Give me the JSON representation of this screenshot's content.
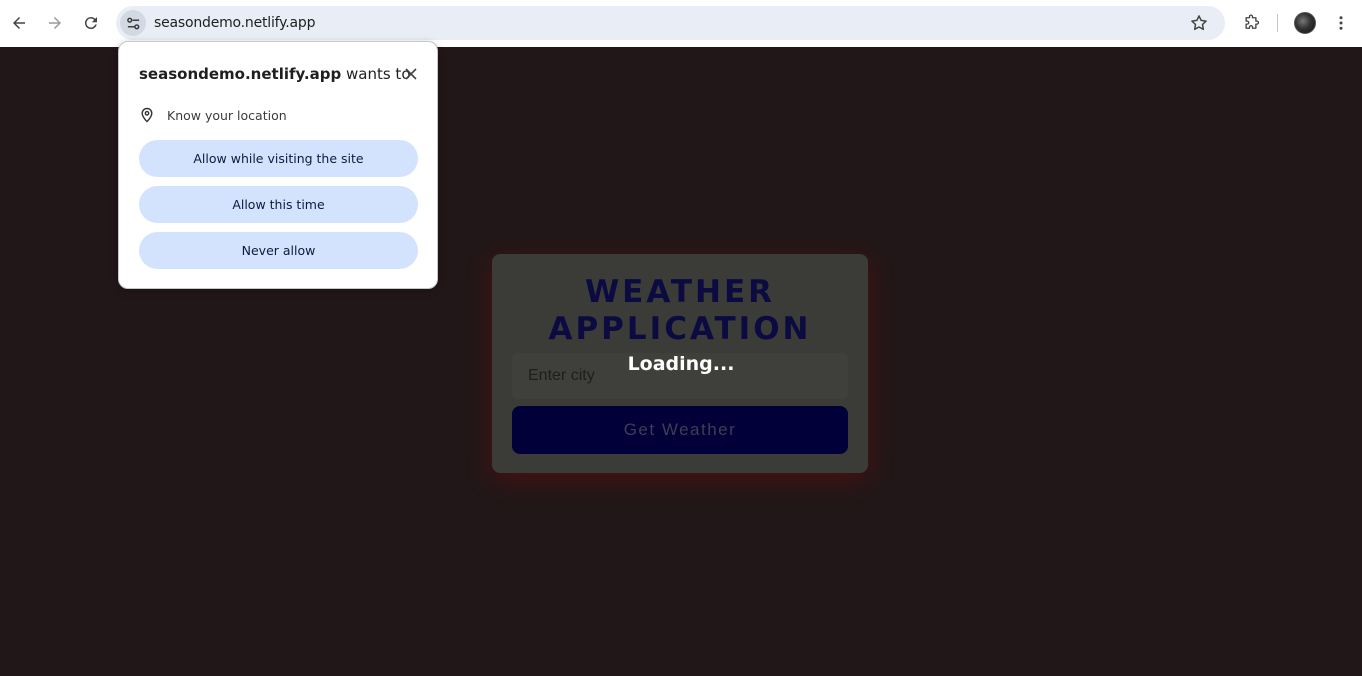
{
  "browser": {
    "url": "seasondemo.netlify.app",
    "icons": {
      "back": "arrow-left-icon",
      "forward": "arrow-right-icon",
      "reload": "reload-icon",
      "site_info": "tune-icon",
      "bookmark": "star-icon",
      "extensions": "puzzle-icon",
      "profile": "avatar",
      "menu": "kebab-menu-icon"
    }
  },
  "permission_popup": {
    "site": "seasondemo.netlify.app",
    "title_suffix": "wants to",
    "permission_label": "Know your location",
    "buttons": {
      "allow_visiting": "Allow while visiting the site",
      "allow_once": "Allow this time",
      "never": "Never allow"
    },
    "button_color": "#d3e3fd"
  },
  "app": {
    "title": "WEATHER APPLICATION",
    "city_placeholder": "Enter city",
    "city_value": "",
    "get_weather_label": "Get Weather",
    "loading_text": "Loading..."
  },
  "colors": {
    "page_background": "#221718",
    "card_background": "#3b3b37",
    "title_color": "#0b0b42",
    "button_background": "#010038"
  }
}
